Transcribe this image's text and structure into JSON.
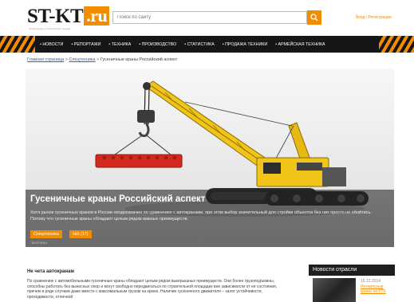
{
  "header": {
    "logo_main": "ST-KT",
    "logo_suffix": ".ru",
    "tagline": "специальная и строительная техника",
    "search_placeholder": "Поиск по сайту",
    "auth_links": "Вход / Регистрация"
  },
  "nav": {
    "items": [
      "НОВОСТИ",
      "РЕПОРТАЖИ",
      "ТЕХНИКА",
      "ПРОИЗВОДСТВО",
      "СТАТИСТИКА",
      "ПРОДАЖА ТЕХНИКИ",
      "АРМЕЙСКАЯ ТЕХНИКА"
    ]
  },
  "breadcrumb": {
    "home": "Главная страница",
    "section": "Спецтехника",
    "current": "Гусеничные краны Российский аспект",
    "separator": ">"
  },
  "hero": {
    "title": "Гусеничные краны Российский аспект",
    "text": "Хотя рынок гусеничных кранов в России неоднозначен по сравнению с автокранами, при этом выбор значительный для стройки объектов без них просто не обойтись. Потому что гусеничные краны обладают целым рядом важных преимуществ.",
    "tags": [
      "Спецтехника",
      "№5 (17)"
    ],
    "date": "15.07.2014"
  },
  "article": {
    "heading": "Не чета автокранам",
    "body": "По сравнению с автомобильными гусеничные краны обладают целым рядом выигрышных преимуществ. Они более грузоподъемны, способны работать без выносных опор и могут свободно передвигаться по строительной площадке вне зависимости от ее состояния, причем в ряде случаев даже вместе с максимальным грузом на крюке. Наличие гусеничного движителя – залог устойчивости, проходимости, отличной"
  },
  "sidebar": {
    "title": "Новости отрасли",
    "news_date": "15.12.2014",
    "news_link": "Интересные краны на КТБ"
  },
  "colors": {
    "accent": "#f28c00",
    "nav_bg": "#161616"
  }
}
